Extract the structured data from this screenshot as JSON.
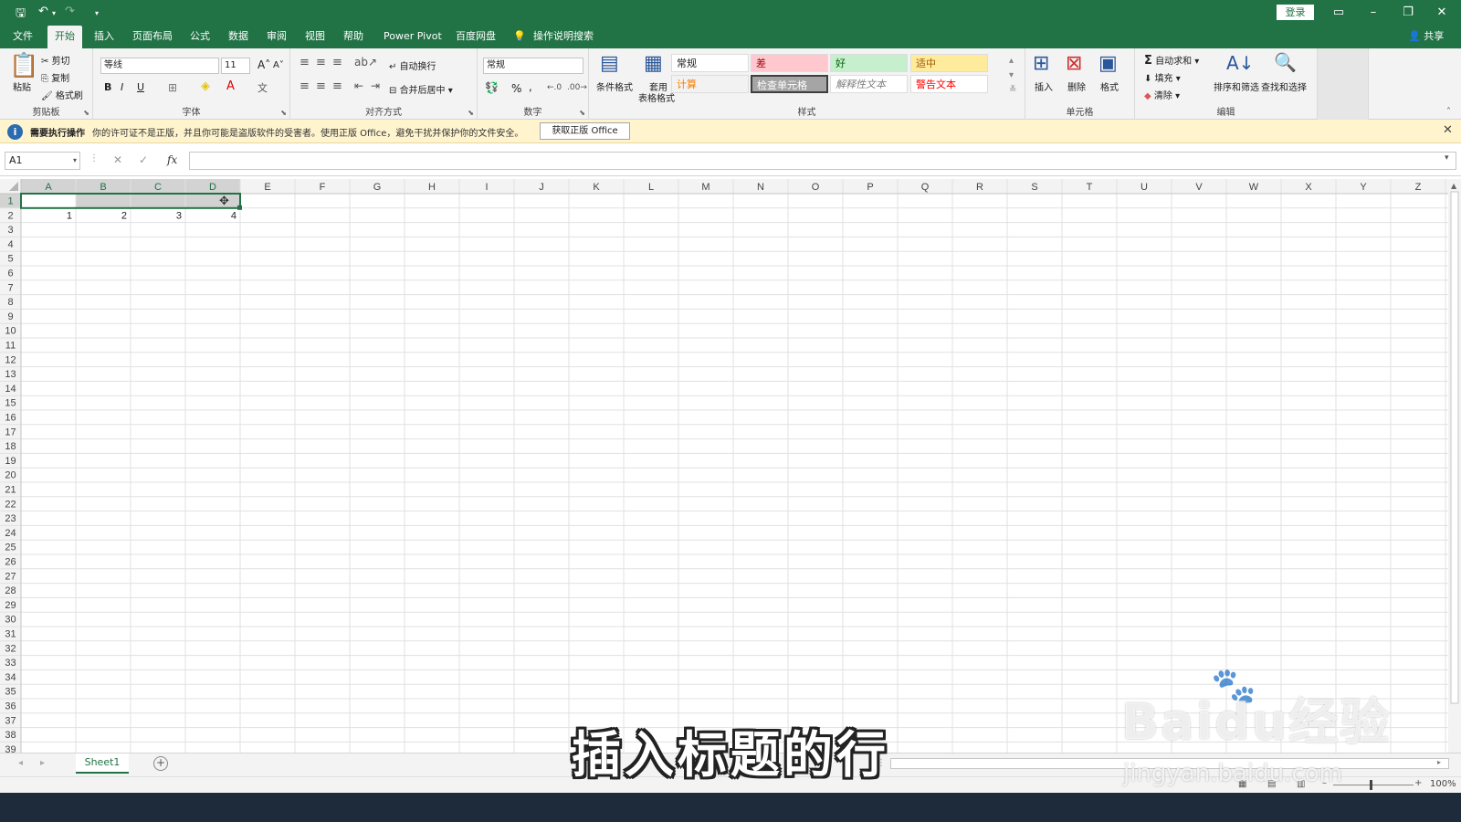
{
  "quick_access": {
    "save_icon": "save-icon",
    "undo_icon": "undo-icon",
    "redo_icon": "redo-icon",
    "more": "▾"
  },
  "title_bar": {
    "login": "登录"
  },
  "tabs": [
    "文件",
    "开始",
    "插入",
    "页面布局",
    "公式",
    "数据",
    "审阅",
    "视图",
    "帮助",
    "Power Pivot",
    "百度网盘",
    "操作说明搜索"
  ],
  "share": "共享",
  "ribbon": {
    "clipboard": {
      "label": "剪贴板",
      "paste": "粘贴",
      "cut": "剪切",
      "copy": "复制",
      "format_painter": "格式刷"
    },
    "font": {
      "label": "字体",
      "name": "等线",
      "size": "11",
      "bold": "B",
      "italic": "I",
      "underline": "U"
    },
    "alignment": {
      "label": "对齐方式",
      "wrap": "自动换行",
      "merge": "合并后居中"
    },
    "number": {
      "label": "数字",
      "format": "常规",
      "percent": "%",
      "comma": ","
    },
    "styles": {
      "label": "样式",
      "conditional": "条件格式",
      "table_line1": "套用",
      "table_line2": "表格格式",
      "cells": [
        {
          "text": "常规",
          "bg": "#ffffff",
          "fg": "#222222"
        },
        {
          "text": "差",
          "bg": "#ffc7ce",
          "fg": "#9c0006"
        },
        {
          "text": "好",
          "bg": "#c6efce",
          "fg": "#006100"
        },
        {
          "text": "适中",
          "bg": "#ffeb9c",
          "fg": "#9c5700"
        },
        {
          "text": "计算",
          "bg": "#f2f2f2",
          "fg": "#fa7d00"
        },
        {
          "text": "检查单元格",
          "bg": "#a5a5a5",
          "fg": "#ffffff"
        },
        {
          "text": "解释性文本",
          "bg": "#ffffff",
          "fg": "#7f7f7f"
        },
        {
          "text": "警告文本",
          "bg": "#ffffff",
          "fg": "#ff0000"
        }
      ]
    },
    "cells": {
      "label": "单元格",
      "insert": "插入",
      "delete": "删除",
      "format": "格式"
    },
    "editing": {
      "label": "编辑",
      "autosum": "自动求和",
      "fill": "填充",
      "clear": "清除",
      "sort": "排序和筛选",
      "find": "查找和选择"
    }
  },
  "message_bar": {
    "title": "需要执行操作",
    "text": "你的许可证不是正版，并且你可能是盗版软件的受害者。使用正版 Office，避免干扰并保护你的文件安全。",
    "button": "获取正版 Office"
  },
  "formula_bar": {
    "name_box": "A1",
    "cancel": "✕",
    "enter": "✓",
    "fx": "fx",
    "value": ""
  },
  "grid": {
    "columns": [
      "A",
      "B",
      "C",
      "D",
      "E",
      "F",
      "G",
      "H",
      "I",
      "J",
      "K",
      "L",
      "M",
      "N",
      "O",
      "P",
      "Q",
      "R",
      "S",
      "T",
      "U",
      "V",
      "W",
      "X",
      "Y",
      "Z"
    ],
    "row_count": 39,
    "cells": {
      "A2": "1",
      "B2": "2",
      "C2": "3",
      "D2": "4"
    }
  },
  "sheet_tabs": {
    "active": "Sheet1",
    "add": "+"
  },
  "status": {
    "zoom": "100%"
  },
  "overlay": {
    "caption": "插入标题的行",
    "watermark": "Baidu经验",
    "watermark_url": "jingyan.baidu.com"
  },
  "colors": {
    "excel_green": "#217346",
    "selection_fill": "#d2d2d2"
  }
}
